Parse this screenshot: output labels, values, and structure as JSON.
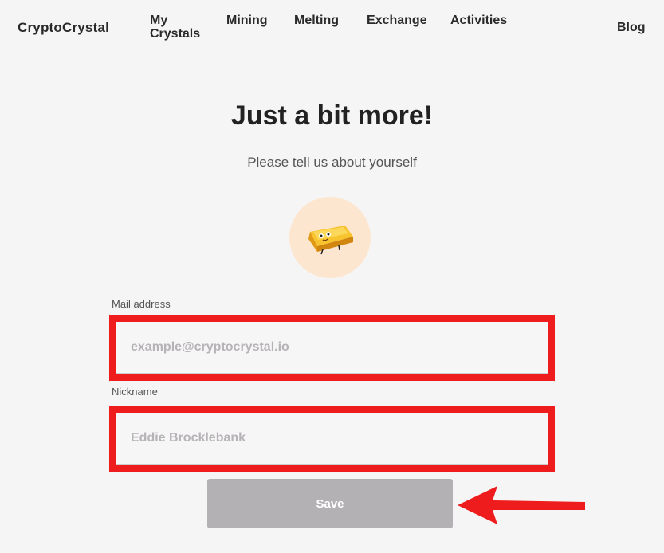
{
  "nav": {
    "brand": "CryptoCrystal",
    "links": [
      {
        "label": "My Crystals"
      },
      {
        "label": "Mining"
      },
      {
        "label": "Melting"
      },
      {
        "label": "Exchange"
      },
      {
        "label": "Activities"
      },
      {
        "label": "Blog"
      }
    ]
  },
  "main": {
    "title": "Just a bit more!",
    "subtitle": "Please tell us about yourself",
    "avatar_icon": "gold-crystal-character-icon"
  },
  "form": {
    "email_label": "Mail address",
    "email_placeholder": "example@cryptocrystal.io",
    "email_value": "",
    "nickname_label": "Nickname",
    "nickname_placeholder": "Eddie Brocklebank",
    "nickname_value": "",
    "save_label": "Save"
  },
  "annotations": {
    "highlight_color": "#ee1c1c",
    "arrow_icon": "left-arrow-icon"
  },
  "colors": {
    "background": "#f6f5f6",
    "avatar_bg": "#fde6cf",
    "button_bg": "#b3b1b3"
  }
}
